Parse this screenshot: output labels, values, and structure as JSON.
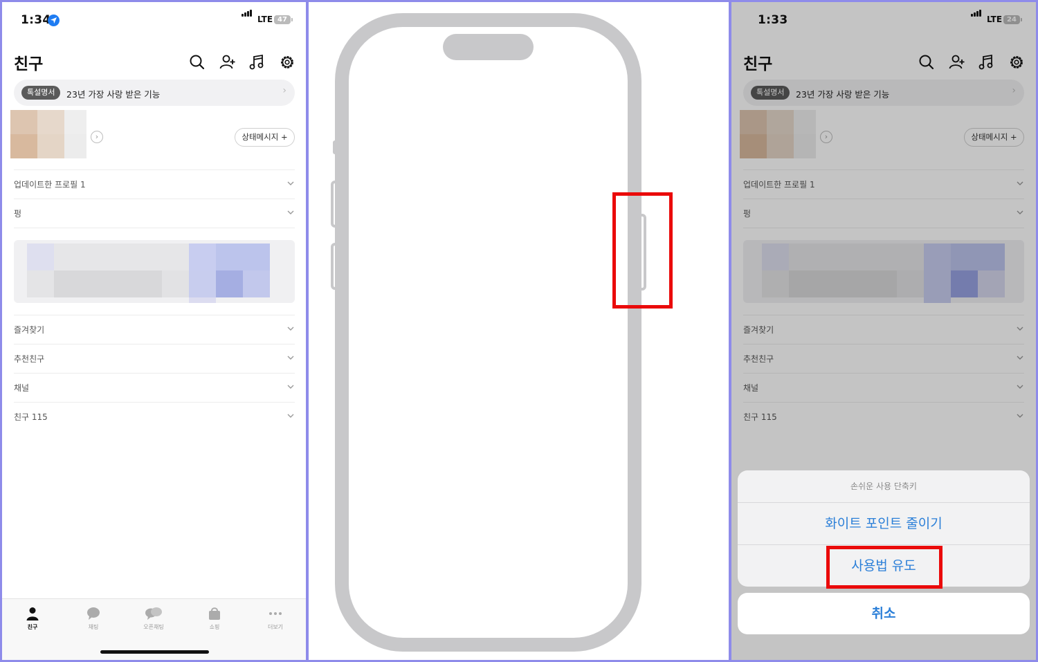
{
  "left_screen": {
    "time": "1:34",
    "network": "LTE",
    "battery": "47",
    "title": "친구",
    "banner": {
      "badge": "톡설명서",
      "text": "23년 가장 사랑 받은 기능"
    },
    "status_message_button": "상태메시지 +",
    "rows_top": [
      "업데이트한 프로필 1",
      "펑"
    ],
    "rows_bottom": [
      "즐겨찾기",
      "추천친구",
      "채널",
      "친구 115"
    ],
    "tabs": [
      "친구",
      "채팅",
      "오픈채팅",
      "쇼핑",
      "더보기"
    ]
  },
  "right_screen": {
    "time": "1:33",
    "network": "LTE",
    "battery": "24",
    "title": "친구",
    "banner": {
      "badge": "톡설명서",
      "text": "23년 가장 사랑 받은 기능"
    },
    "status_message_button": "상태메시지 +",
    "rows_top": [
      "업데이트한 프로필 1",
      "펑"
    ],
    "rows_bottom": [
      "즐겨찾기",
      "추천친구",
      "채널",
      "친구 115"
    ],
    "action_sheet": {
      "title": "손쉬운 사용 단축키",
      "options": [
        "화이트 포인트 줄이기",
        "사용법 유도"
      ],
      "cancel": "취소"
    }
  },
  "colors": {
    "accent": "#2b7fd8",
    "highlight": "#ea0a0a",
    "frame": "#8e8bea",
    "phone_outline": "#c8c8ca"
  },
  "icons": [
    "location-arrow-icon",
    "signal-icon",
    "battery-icon",
    "search-icon",
    "add-friend-icon",
    "music-icon",
    "gear-icon",
    "chevron-right-icon",
    "chevron-down-icon",
    "person-icon",
    "chat-bubble-icon",
    "open-chat-icon",
    "shopping-bag-icon",
    "more-icon"
  ]
}
